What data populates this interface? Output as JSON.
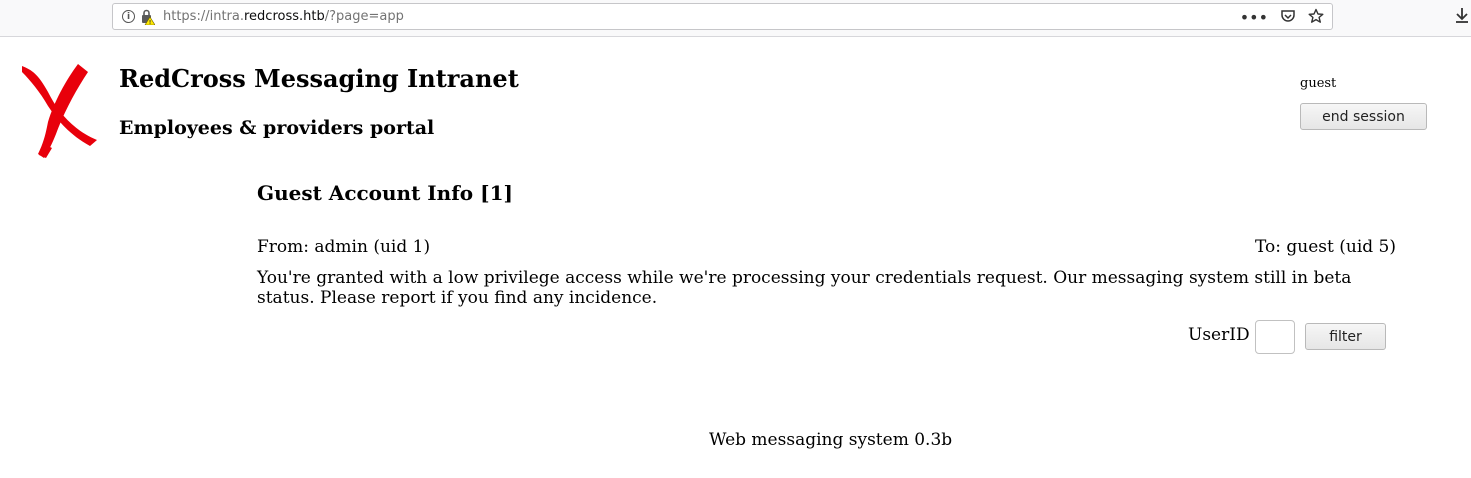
{
  "browser": {
    "url_prefix": "https://intra.",
    "url_host": "redcross.htb",
    "url_suffix": "/?page=app",
    "icons": [
      "info-icon",
      "lock-warning-icon",
      "more-icon",
      "pocket-icon",
      "bookmark-star-icon",
      "download-icon"
    ]
  },
  "header": {
    "title": "RedCross Messaging Intranet",
    "subtitle": "Employees & providers portal",
    "logo_color": "#e8000b"
  },
  "session": {
    "username": "guest",
    "end_session_label": "end session"
  },
  "message": {
    "subject": "Guest Account Info [1]",
    "from": "From: admin (uid 1)",
    "to": "To: guest (uid 5)",
    "body": "You're granted with a low privilege access while we're processing your credentials request. Our messaging system still in beta status. Please report if you find any incidence."
  },
  "filter": {
    "label": "UserID",
    "input_value": "",
    "button_label": "filter"
  },
  "footer": {
    "text": "Web messaging system 0.3b"
  }
}
